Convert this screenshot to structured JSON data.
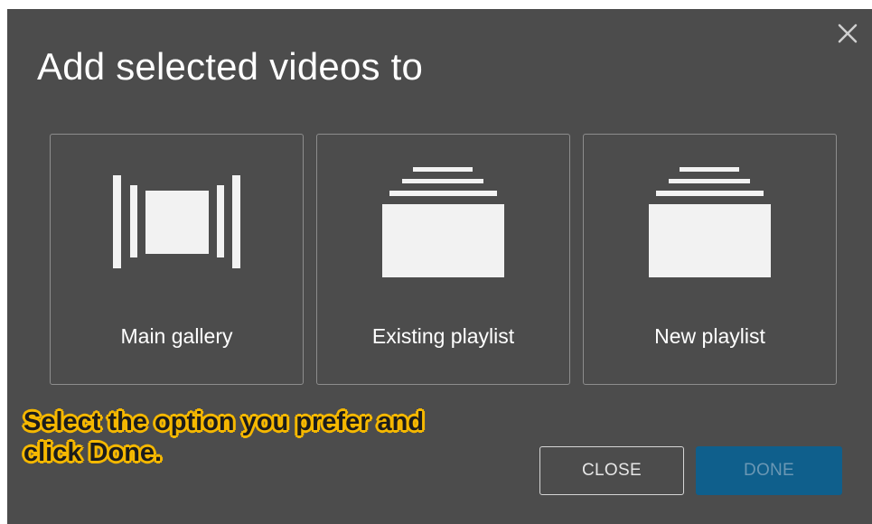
{
  "dialog": {
    "title": "Add selected videos to",
    "close_icon": "close-icon"
  },
  "options": [
    {
      "label": "Main gallery",
      "icon": "gallery-icon"
    },
    {
      "label": "Existing playlist",
      "icon": "playlist-stack-icon"
    },
    {
      "label": "New playlist",
      "icon": "playlist-stack-icon"
    }
  ],
  "callout": {
    "line1": "Select the option you prefer and",
    "line2": "click Done."
  },
  "buttons": {
    "close_label": "CLOSE",
    "done_label": "DONE"
  },
  "colors": {
    "dialog_bg": "#4c4c4c",
    "done_bg": "#0f5f8c",
    "callout_highlight": "#f6b800"
  }
}
